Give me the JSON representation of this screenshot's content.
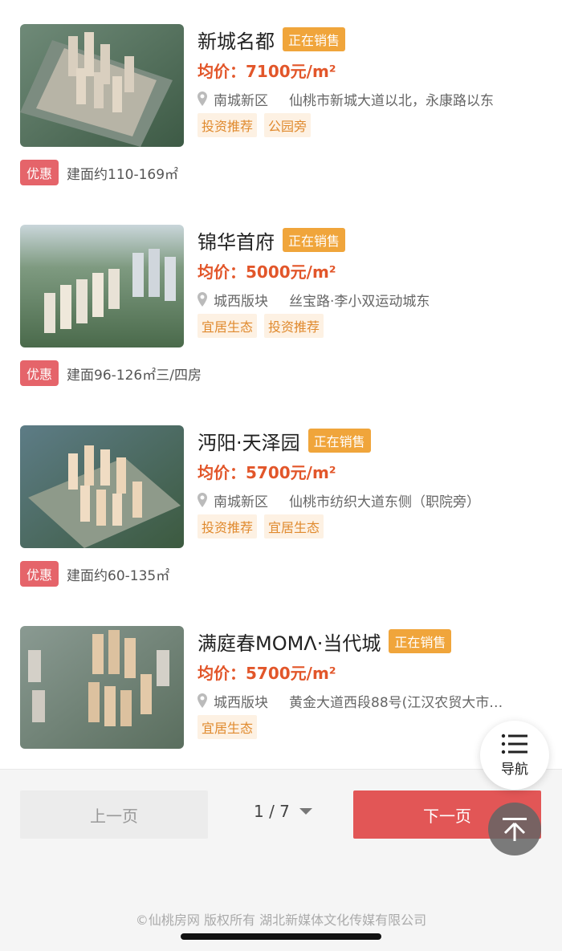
{
  "listings": [
    {
      "name": "新城名都",
      "status": "正在销售",
      "price": "均价：7100元/m²",
      "district": "南城新区",
      "address": "仙桃市新城大道以北，永康路以东",
      "tags": [
        "投资推荐",
        "公园旁"
      ],
      "promo_label": "优惠",
      "promo_text": "建面约110-169㎡"
    },
    {
      "name": "锦华首府",
      "status": "正在销售",
      "price": "均价：5000元/m²",
      "district": "城西版块",
      "address": "丝宝路·李小双运动城东",
      "tags": [
        "宜居生态",
        "投资推荐"
      ],
      "promo_label": "优惠",
      "promo_text": "建面96-126㎡三/四房"
    },
    {
      "name": "沔阳·天泽园",
      "status": "正在销售",
      "price": "均价：5700元/m²",
      "district": "南城新区",
      "address": "仙桃市纺织大道东侧（职院旁）",
      "tags": [
        "投资推荐",
        "宜居生态"
      ],
      "promo_label": "优惠",
      "promo_text": "建面约60-135㎡"
    },
    {
      "name": "满庭春MOMΛ·当代城",
      "status": "正在销售",
      "price": "均价：5700元/m²",
      "district": "城西版块",
      "address": "黄金大道西段88号(江汉农贸大市…",
      "tags": [
        "宜居生态"
      ],
      "promo_label": "",
      "promo_text": ""
    }
  ],
  "pager": {
    "prev_label": "上一页",
    "page_indicator": "1 / 7",
    "next_label": "下一页"
  },
  "fab": {
    "nav_label": "导航"
  },
  "footer": {
    "copyright": "©仙桃房网 版权所有 湖北新媒体文化传媒有限公司"
  },
  "colors": {
    "status_badge": "#f0a53b",
    "price": "#e2562a",
    "tag_bg": "#fdf1e3",
    "tag_text": "#e08a2e",
    "promo_badge": "#e5646a",
    "next_button": "#e25656"
  }
}
